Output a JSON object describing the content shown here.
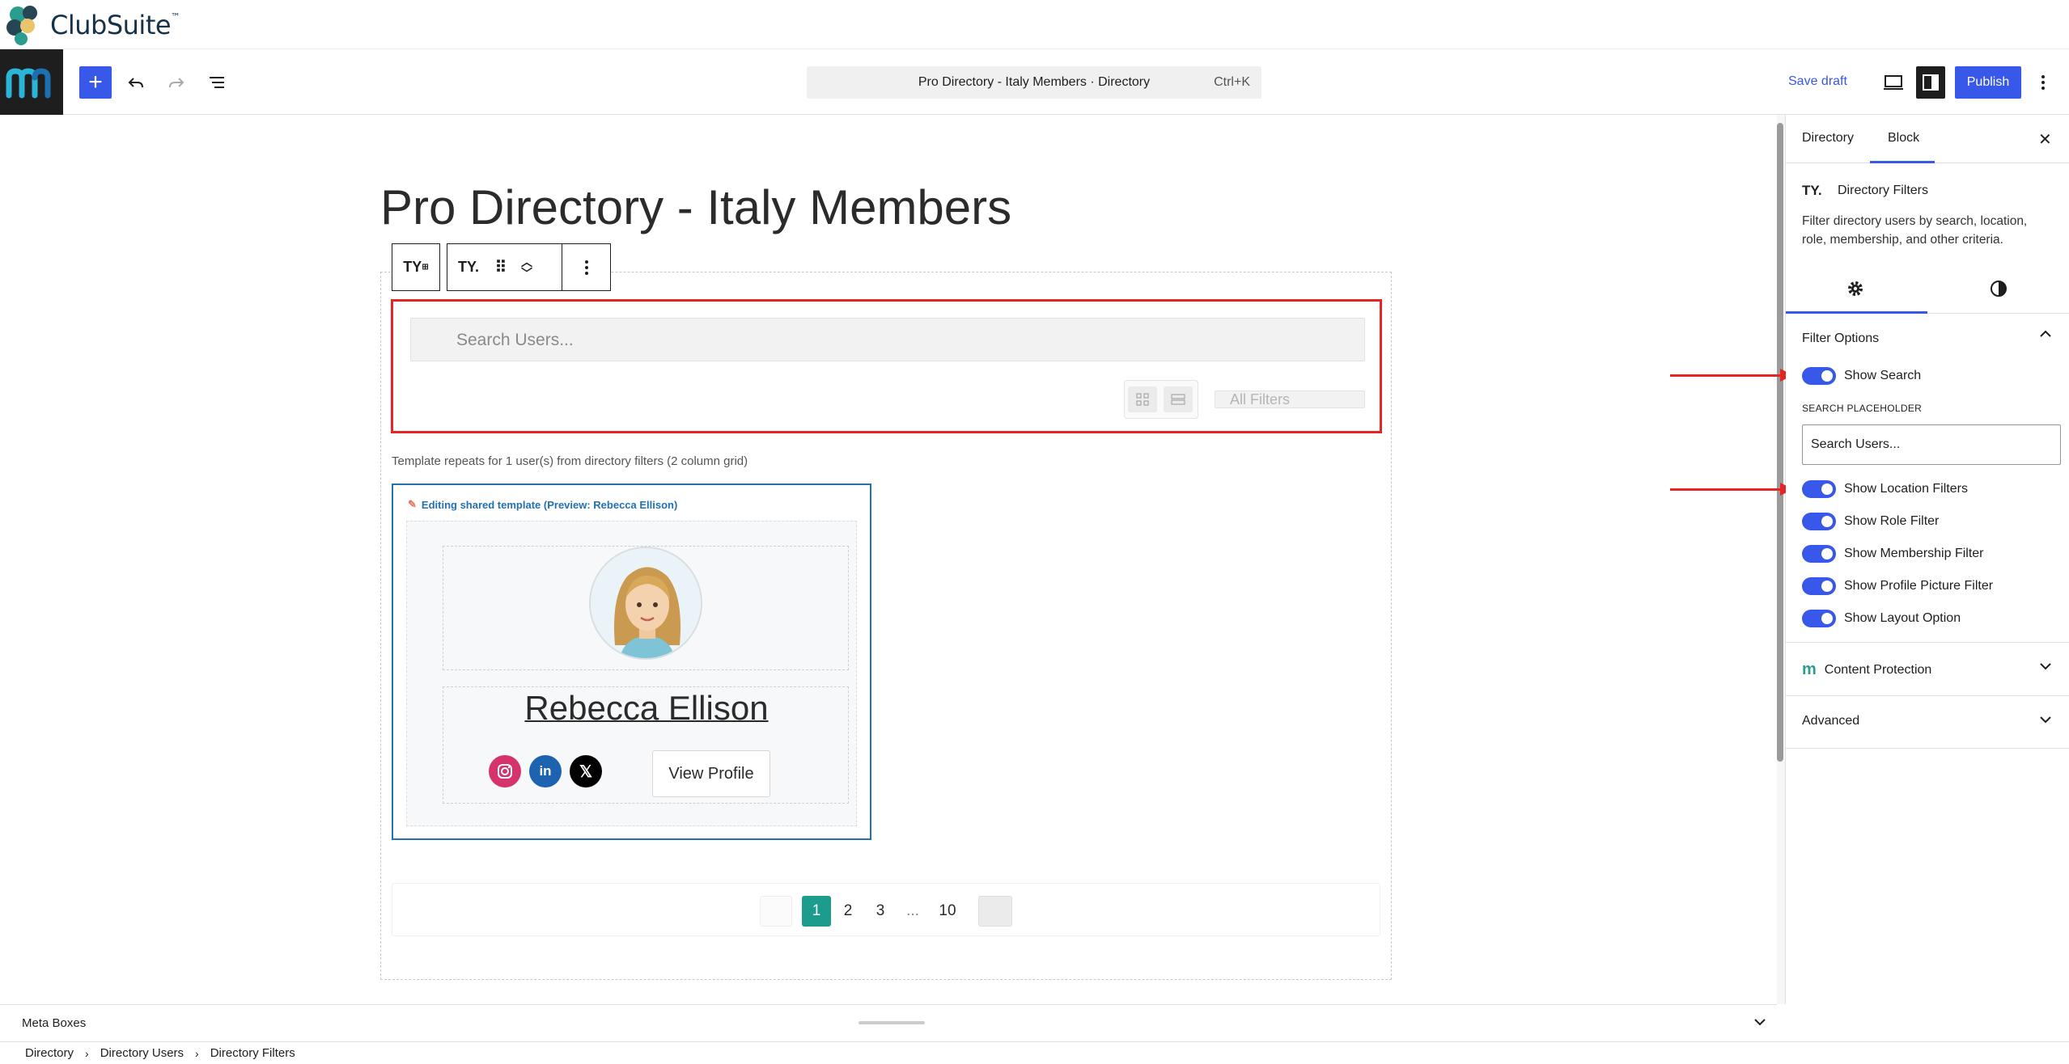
{
  "brand": {
    "name": "ClubSuite",
    "tm": "™"
  },
  "header": {
    "command_bar_title": "Pro Directory - Italy Members · Directory",
    "command_shortcut": "Ctrl+K",
    "save_draft": "Save draft",
    "publish": "Publish"
  },
  "editor": {
    "page_title": "Pro Directory - Italy Members",
    "search_placeholder": "Search Users...",
    "all_filters": "All Filters",
    "template_note": "Template repeats for 1 user(s) from directory filters (2 column grid)",
    "template_label": "Editing shared template (Preview: Rebecca Ellison)",
    "member_name": "Rebecca Ellison",
    "view_profile": "View Profile",
    "social": [
      "instagram",
      "linkedin",
      "x"
    ],
    "pagination": [
      "1",
      "2",
      "3",
      "...",
      "10"
    ],
    "current_page": "1"
  },
  "sidebar": {
    "tabs": [
      "Directory",
      "Block"
    ],
    "active_tab": "Block",
    "block_title": "Directory Filters",
    "block_description": "Filter directory users by search, location, role, membership, and other criteria.",
    "panel_title": "Filter Options",
    "toggles": [
      {
        "label": "Show Search",
        "on": true
      },
      {
        "label": "Show Location Filters",
        "on": true
      },
      {
        "label": "Show Role Filter",
        "on": true
      },
      {
        "label": "Show Membership Filter",
        "on": true
      },
      {
        "label": "Show Profile Picture Filter",
        "on": true
      },
      {
        "label": "Show Layout Option",
        "on": true
      }
    ],
    "placeholder_label": "SEARCH PLACEHOLDER",
    "placeholder_value": "Search Users...",
    "sections": [
      "Content Protection",
      "Advanced"
    ]
  },
  "footer": {
    "meta_boxes": "Meta Boxes",
    "breadcrumb": [
      "Directory",
      "Directory Users",
      "Directory Filters"
    ]
  },
  "colors": {
    "accent": "#3858e9",
    "annotation_red": "#e52424",
    "pagination_active": "#1c9c8c",
    "template_border": "#2271b1"
  }
}
